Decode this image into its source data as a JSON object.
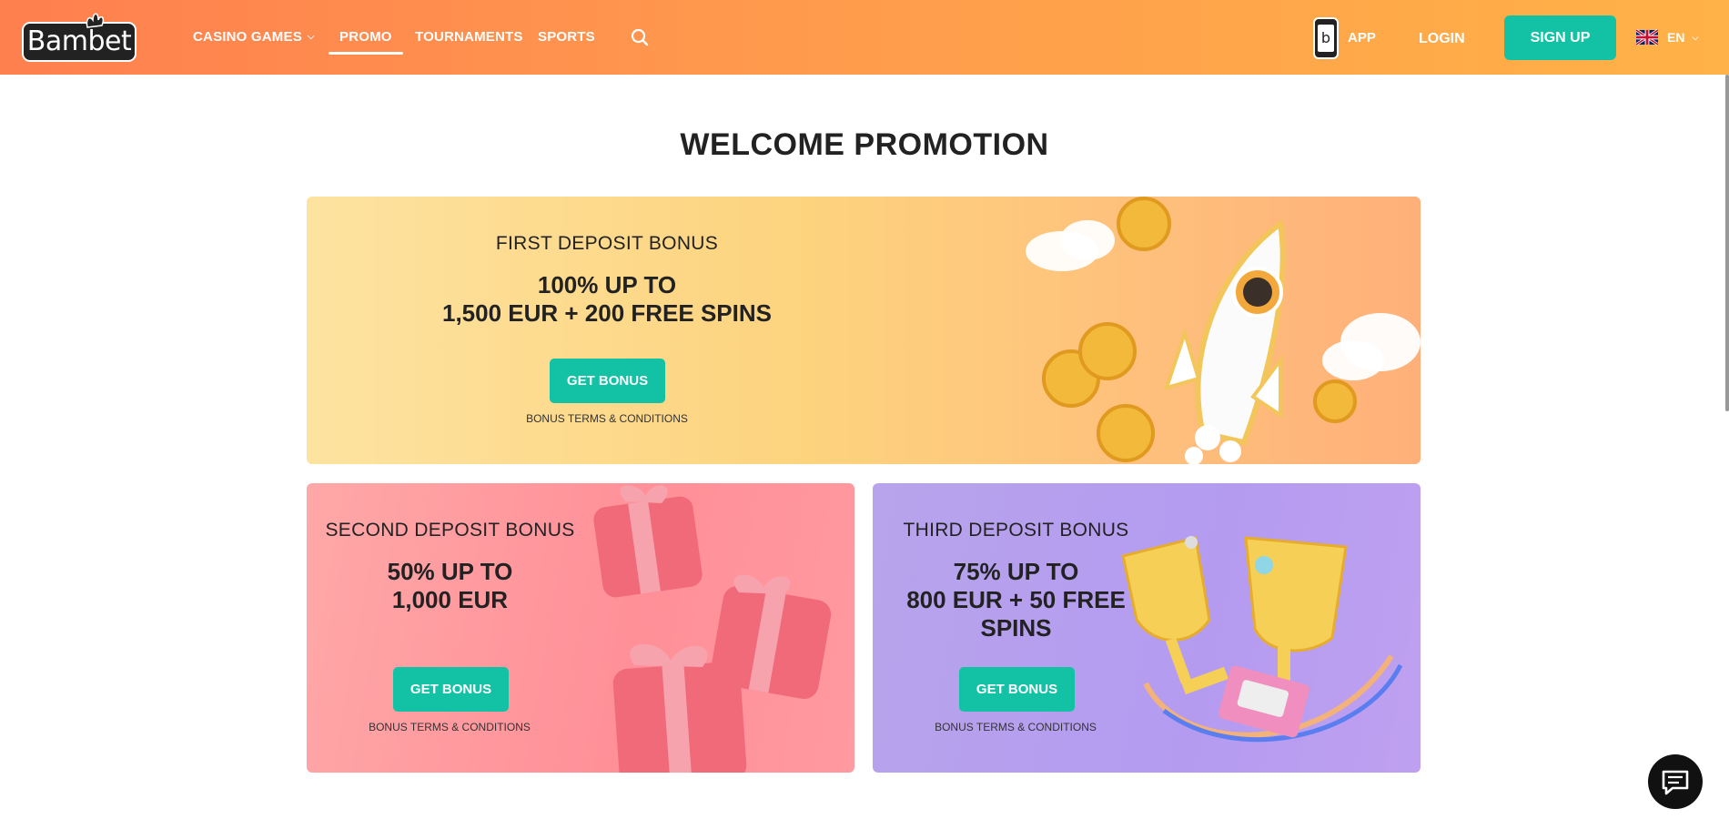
{
  "header": {
    "logo_text": "Bambet",
    "nav": [
      {
        "label": "CASINO GAMES",
        "has_dropdown": true
      },
      {
        "label": "PROMO",
        "active": true
      },
      {
        "label": "TOURNAMENTS"
      },
      {
        "label": "SPORTS"
      }
    ],
    "app_label": "APP",
    "login_label": "LOGIN",
    "signup_label": "SIGN UP",
    "language": "EN",
    "icons": [
      "search-icon",
      "phone-app-icon",
      "uk-flag-icon",
      "chevron-down-icon"
    ]
  },
  "main": {
    "title": "WELCOME PROMOTION",
    "promos": [
      {
        "name": "FIRST DEPOSIT BONUS",
        "offer_line1": "100% UP TO",
        "offer_line2": "1,500 EUR + 200 FREE SPINS",
        "offer_line3": "",
        "button": "GET BONUS",
        "terms": "BONUS TERMS & CONDITIONS"
      },
      {
        "name": "SECOND DEPOSIT BONUS",
        "offer_line1": "50% UP TO",
        "offer_line2": "1,000 EUR",
        "offer_line3": "",
        "button": "GET BONUS",
        "terms": "BONUS TERMS & CONDITIONS"
      },
      {
        "name": "THIRD DEPOSIT BONUS",
        "offer_line1": "75% UP TO",
        "offer_line2": "800 EUR + 50 FREE",
        "offer_line3": "SPINS",
        "button": "GET BONUS",
        "terms": "BONUS TERMS & CONDITIONS"
      }
    ]
  },
  "chat": {
    "icon": "chat-icon"
  },
  "colors": {
    "accent": "#13c2a4",
    "header_start": "#ff7f4f",
    "header_end": "#ffb247"
  }
}
